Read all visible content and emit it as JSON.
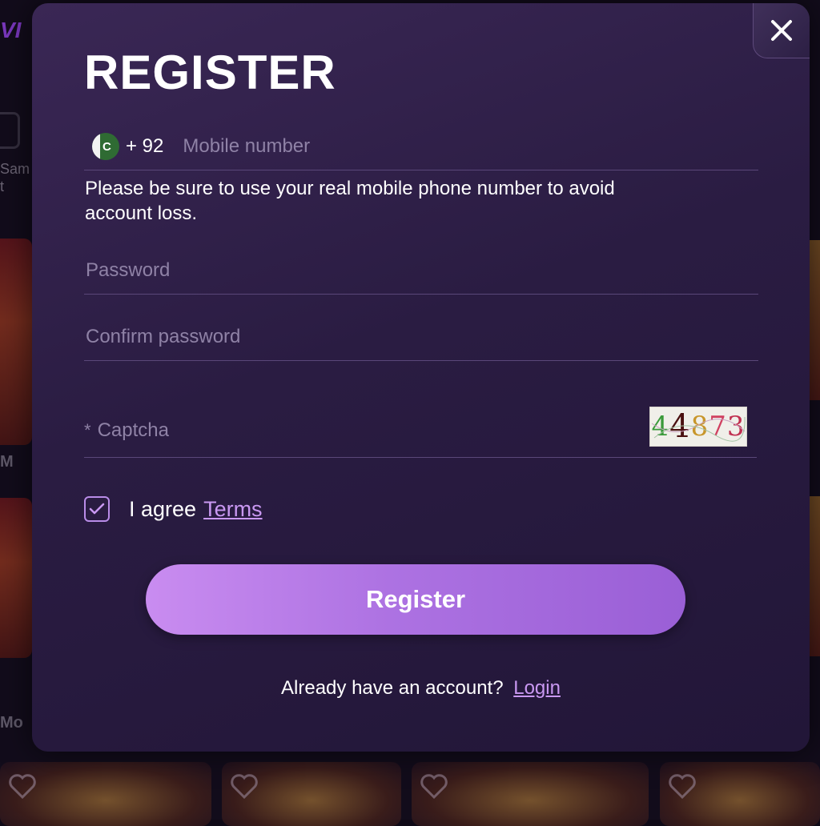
{
  "modal": {
    "title": "REGISTER",
    "phone": {
      "country_code": "+ 92",
      "placeholder": "Mobile number",
      "flag_icon": "pakistan-flag-icon"
    },
    "hint": "Please be sure to use your real mobile phone number to avoid account loss.",
    "password": {
      "placeholder": "Password"
    },
    "confirm_password": {
      "placeholder": "Confirm password"
    },
    "captcha": {
      "required_mark": "*",
      "placeholder": "Captcha",
      "code_digits": [
        "4",
        "4",
        "8",
        "7",
        "3"
      ]
    },
    "agree": {
      "checked": true,
      "text": "I agree",
      "terms_link": "Terms"
    },
    "register_button": "Register",
    "login_prompt": "Already have an account?",
    "login_link": "Login",
    "close_icon": "close-icon"
  },
  "background": {
    "partial_text_1": "Sam",
    "partial_text_2": "t",
    "partial_more_1": "M",
    "partial_more_2": "Mo"
  },
  "colors": {
    "modal_bg": "#2a1c42",
    "accent": "#c998f2",
    "button_gradient_start": "#c98cf0",
    "button_gradient_end": "#9a5fd6"
  }
}
